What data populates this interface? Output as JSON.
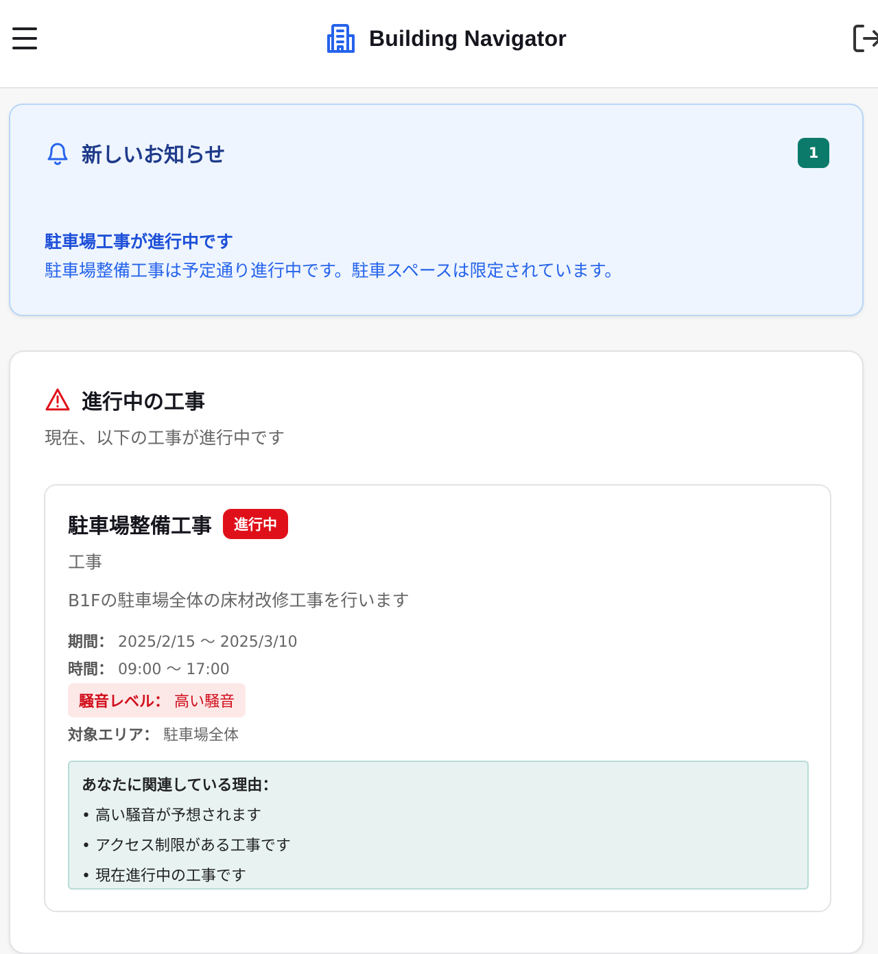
{
  "header": {
    "title": "Building Navigator",
    "menu_icon": "hamburger-menu-icon",
    "brand_icon": "building-icon",
    "logout_icon": "logout-icon"
  },
  "notifications": {
    "title": "新しいお知らせ",
    "count": "1",
    "items": [
      {
        "title": "駐車場工事が進行中です",
        "body": "駐車場整備工事は予定通り進行中です。駐車スペースは限定されています。"
      }
    ]
  },
  "works": {
    "title": "進行中の工事",
    "subtitle": "現在、以下の工事が進行中です",
    "items": [
      {
        "title": "駐車場整備工事",
        "status": "進行中",
        "category": "工事",
        "description": "B1Fの駐車場全体の床材改修工事を行います",
        "period_label": "期間：",
        "period": "2025/2/15 〜 2025/3/10",
        "time_label": "時間：",
        "time": "09:00 〜 17:00",
        "noise_label": "騒音レベル：",
        "noise": "高い騒音",
        "area_label": "対象エリア：",
        "area": "駐車場全体",
        "reasons_title": "あなたに関連している理由：",
        "reasons": [
          "• 高い騒音が予想されます",
          "• アクセス制限がある工事です",
          "• 現在進行中の工事です"
        ]
      }
    ]
  },
  "colors": {
    "accent_blue": "#2563eb",
    "badge_green": "#0b7a6b",
    "status_red": "#e0101a",
    "reason_bg": "#e7f2f1"
  }
}
